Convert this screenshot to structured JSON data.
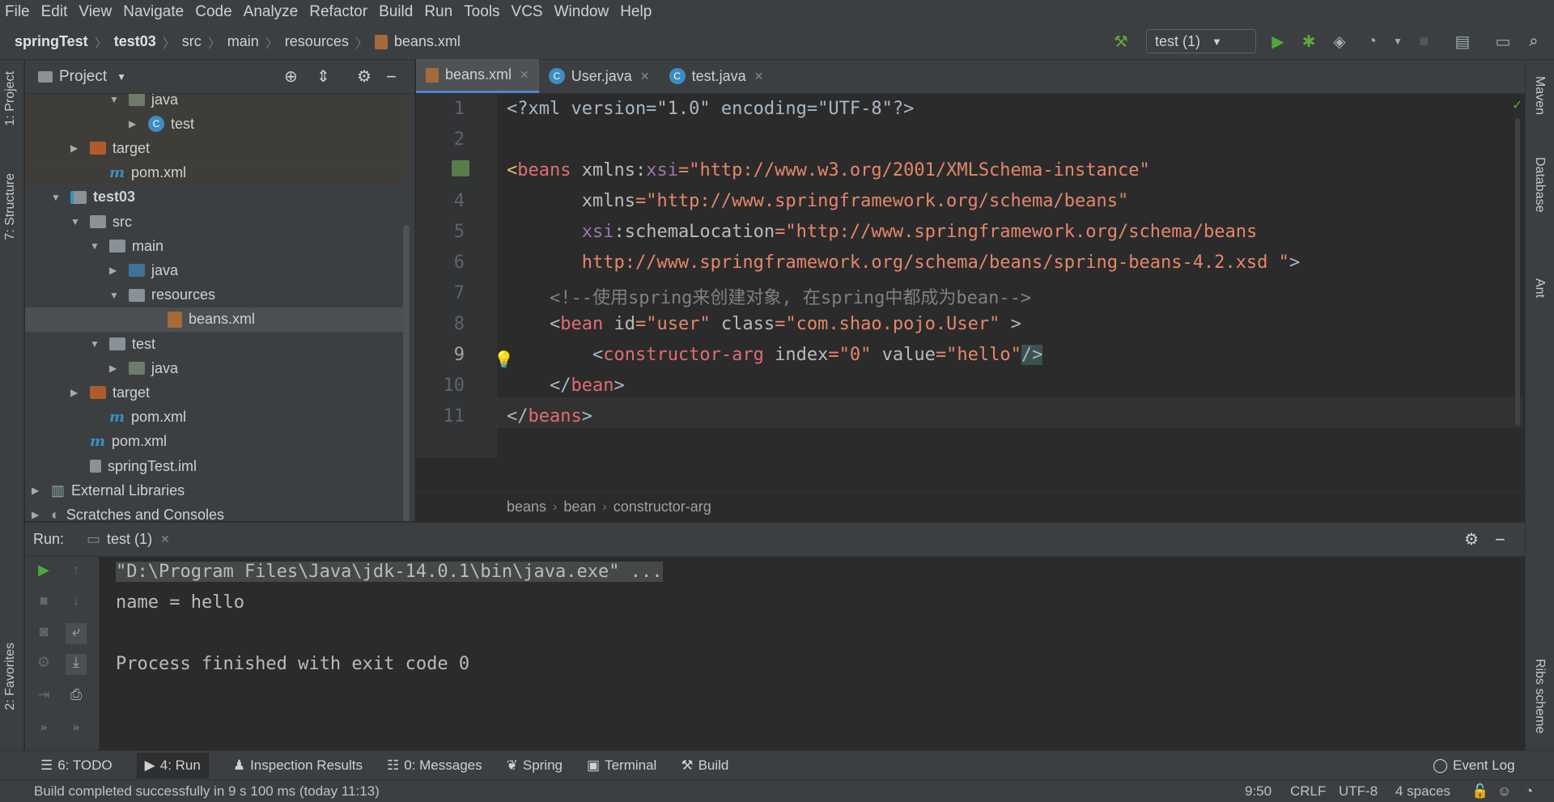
{
  "menu": [
    "File",
    "Edit",
    "View",
    "Navigate",
    "Code",
    "Analyze",
    "Refactor",
    "Build",
    "Run",
    "Tools",
    "VCS",
    "Window",
    "Help"
  ],
  "breadcrumb": [
    "springTest",
    "test03",
    "src",
    "main",
    "resources",
    "beans.xml"
  ],
  "run_config": "test (1)",
  "left_tabs": [
    "1: Project",
    "7: Structure",
    "2: Favorites"
  ],
  "right_tabs": [
    "Maven",
    "Database",
    "Ant",
    "Ribs scheme"
  ],
  "project_panel": {
    "title": "Project",
    "tree": [
      {
        "label": "java",
        "indent": 4,
        "icon": "folder-g",
        "arrow": "▼"
      },
      {
        "label": "test",
        "indent": 5,
        "icon": "class",
        "arrow": "▶"
      },
      {
        "label": "target",
        "indent": 2,
        "icon": "folder-o",
        "arrow": "▶"
      },
      {
        "label": "pom.xml",
        "indent": 3,
        "icon": "maven",
        "arrow": ""
      },
      {
        "label": "test03",
        "indent": 1,
        "icon": "module",
        "arrow": "▼",
        "bold": true
      },
      {
        "label": "src",
        "indent": 2,
        "icon": "folder-grey",
        "arrow": "▼"
      },
      {
        "label": "main",
        "indent": 3,
        "icon": "folder-grey",
        "arrow": "▼"
      },
      {
        "label": "java",
        "indent": 4,
        "icon": "folder-b",
        "arrow": "▶"
      },
      {
        "label": "resources",
        "indent": 4,
        "icon": "folder-grey",
        "arrow": "▼"
      },
      {
        "label": "beans.xml",
        "indent": 6,
        "icon": "xml",
        "arrow": "",
        "selected": true
      },
      {
        "label": "test",
        "indent": 3,
        "icon": "folder-grey",
        "arrow": "▼"
      },
      {
        "label": "java",
        "indent": 4,
        "icon": "folder-g",
        "arrow": "▶"
      },
      {
        "label": "target",
        "indent": 2,
        "icon": "folder-o",
        "arrow": "▶"
      },
      {
        "label": "pom.xml",
        "indent": 3,
        "icon": "maven",
        "arrow": ""
      },
      {
        "label": "pom.xml",
        "indent": 2,
        "icon": "maven",
        "arrow": ""
      },
      {
        "label": "springTest.iml",
        "indent": 2,
        "icon": "iml",
        "arrow": ""
      },
      {
        "label": "External Libraries",
        "indent": 0,
        "icon": "lib",
        "arrow": "▶"
      },
      {
        "label": "Scratches and Consoles",
        "indent": 0,
        "icon": "scratch",
        "arrow": "▶"
      }
    ]
  },
  "editor_tabs": [
    {
      "label": "beans.xml",
      "active": true
    },
    {
      "label": "User.java",
      "active": false
    },
    {
      "label": "test.java",
      "active": false
    }
  ],
  "line_numbers": [
    "1",
    "2",
    "3",
    "4",
    "5",
    "6",
    "7",
    "8",
    "9",
    "10",
    "11"
  ],
  "code": {
    "l1": "<?xml version=\"1.0\" encoding=\"UTF-8\"?>",
    "l3a": "<",
    "l3b": "beans",
    "l3c": " xmlns:",
    "l3d": "xsi",
    "l3e": "=\"http://www.w3.org/2001/XMLSchema-instance\"",
    "l4a": "       xmlns",
    "l4b": "=\"http://www.springframework.org/schema/beans\"",
    "l5a": "       ",
    "l5b": "xsi",
    "l5c": ":schemaLocation",
    "l5d": "=\"http://www.springframework.org/schema/beans",
    "l6": "       http://www.springframework.org/schema/beans/spring-beans-4.2.xsd \"",
    "l6b": ">",
    "l7": "    <!--使用spring来创建对象, 在spring中都成为bean-->",
    "l8a": "    <",
    "l8b": "bean",
    "l8c": " id",
    "l8d": "=\"user\"",
    "l8e": " class",
    "l8f": "=\"com.shao.pojo.User\"",
    "l8g": " >",
    "l9a": "        <",
    "l9b": "constructor-arg",
    "l9c": " index",
    "l9d": "=\"0\"",
    "l9e": " value",
    "l9f": "=\"hello\"",
    "l9g": "/>",
    "l10a": "    </",
    "l10b": "bean",
    "l10c": ">",
    "l11a": "</",
    "l11b": "beans",
    "l11c": ">"
  },
  "editor_breadcrumb": [
    "beans",
    "bean",
    "constructor-arg"
  ],
  "run": {
    "label": "Run:",
    "tab": "test (1)",
    "console": [
      "\"D:\\Program Files\\Java\\jdk-14.0.1\\bin\\java.exe\" ...",
      "name = hello",
      "",
      "Process finished with exit code 0"
    ]
  },
  "bottom_tabs": [
    "6: TODO",
    "4: Run",
    "Inspection Results",
    "0: Messages",
    "Spring",
    "Terminal",
    "Build"
  ],
  "event_log": "Event Log",
  "status": {
    "message": "Build completed successfully in 9 s 100 ms (today 11:13)",
    "position": "9:50",
    "line_sep": "CRLF",
    "encoding": "UTF-8",
    "indent": "4 spaces"
  }
}
